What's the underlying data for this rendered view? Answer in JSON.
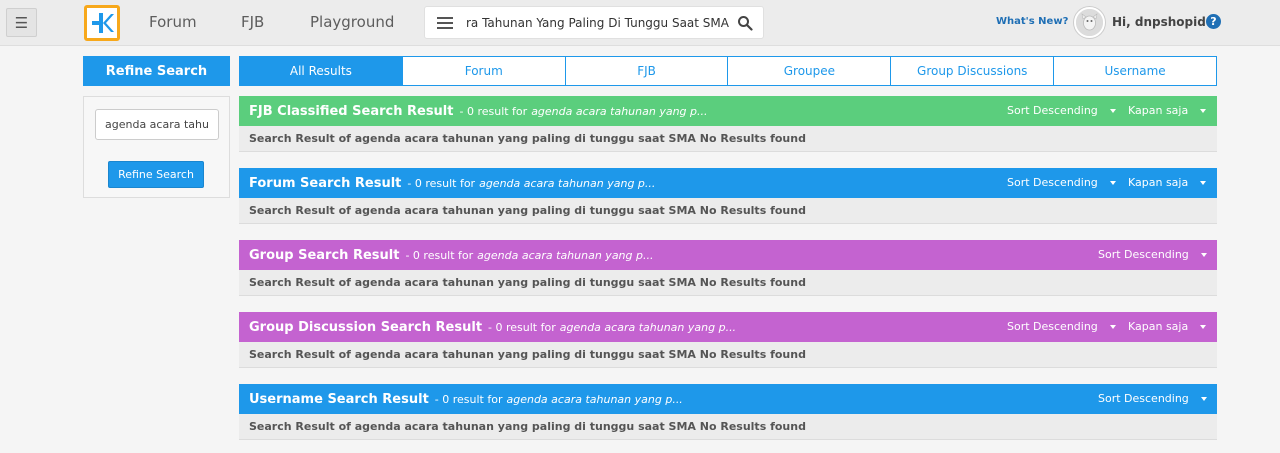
{
  "nav": {
    "forum": "Forum",
    "fjb": "FJB",
    "playground": "Playground"
  },
  "search": {
    "value": "agenda Acara Tahunan Yang Paling Di Tunggu Saat SMA"
  },
  "user": {
    "whats_new": "What's New?",
    "greeting": "Hi, dnpshopid",
    "help": "?"
  },
  "sidebar": {
    "title": "Refine Search",
    "input_value": "agenda acara tahunan yang paling di tunggu saat SMA",
    "button_label": "Refine Search"
  },
  "tabs": [
    {
      "label": "All Results"
    },
    {
      "label": "Forum"
    },
    {
      "label": "FJB"
    },
    {
      "label": "Groupee"
    },
    {
      "label": "Group Discussions"
    },
    {
      "label": "Username"
    }
  ],
  "sections": [
    {
      "title": "FJB Classified Search Result",
      "count": "- 0 result for",
      "query": "agenda acara tahunan yang p...",
      "sort": "Sort Descending",
      "time": "Kapan saja",
      "message": "Search Result of agenda acara tahunan yang paling di tunggu saat SMA No Results found",
      "color": "#5bce7d"
    },
    {
      "title": "Forum Search Result",
      "count": "- 0 result for",
      "query": "agenda acara tahunan yang p...",
      "sort": "Sort Descending",
      "time": "Kapan saja",
      "message": "Search Result of agenda acara tahunan yang paling di tunggu saat SMA No Results found",
      "color": "#1e98ea"
    },
    {
      "title": "Group Search Result",
      "count": "- 0 result for",
      "query": "agenda acara tahunan yang p...",
      "sort": "Sort Descending",
      "message": "Search Result of agenda acara tahunan yang paling di tunggu saat SMA No Results found",
      "color": "#c463d0"
    },
    {
      "title": "Group Discussion Search Result",
      "count": "- 0 result for",
      "query": "agenda acara tahunan yang p...",
      "sort": "Sort Descending",
      "time": "Kapan saja",
      "message": "Search Result of agenda acara tahunan yang paling di tunggu saat SMA No Results found",
      "color": "#c463d0"
    },
    {
      "title": "Username Search Result",
      "count": "- 0 result for",
      "query": "agenda acara tahunan yang p...",
      "sort": "Sort Descending",
      "message": "Search Result of agenda acara tahunan yang paling di tunggu saat SMA No Results found",
      "color": "#1e98ea"
    }
  ],
  "colors": {
    "primary": "#1e98ea",
    "fjb_green": "#5bce7d",
    "group_purple": "#c463d0",
    "logo_orange": "#f7a81b"
  }
}
